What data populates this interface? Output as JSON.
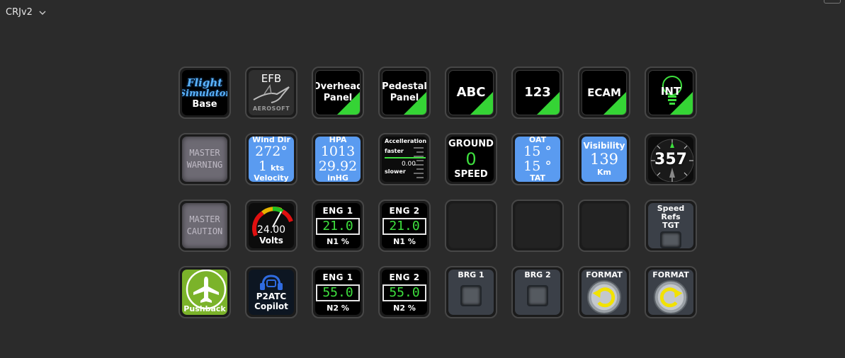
{
  "profile": {
    "name": "CRJv2"
  },
  "keys": {
    "fs_base": {
      "line1": "Flight",
      "line2": "Simulator",
      "label": "Base"
    },
    "efb": {
      "title": "EFB",
      "brand": "AEROSOFT"
    },
    "overhead": {
      "line1": "Overhead",
      "line2": "Panel"
    },
    "pedestal": {
      "line1": "Pedestal",
      "line2": "Panel"
    },
    "abc": {
      "label": "ABC"
    },
    "n123": {
      "label": "123"
    },
    "ecam": {
      "label": "ECAM"
    },
    "int": {
      "label": "INT"
    },
    "master_warning": {
      "line1": "MASTER",
      "line2": "WARNING"
    },
    "wind": {
      "title": "Wind Dir",
      "dir": "272°",
      "speed": "1",
      "unit": "kts",
      "footer": "Velocity"
    },
    "hpa": {
      "title": "HPA",
      "hpa": "1013",
      "inhg": "29.92",
      "footer": "inHG"
    },
    "accel": {
      "title": "Accelleration",
      "faster": "faster",
      "value": "0.00",
      "slower": "slower"
    },
    "ground": {
      "title": "GROUND",
      "value": "0",
      "footer": "SPEED"
    },
    "oat": {
      "title": "OAT",
      "oat": "15 °",
      "tat": "15 °",
      "footer": "TAT"
    },
    "visibility": {
      "title": "Visibility",
      "value": "139",
      "unit": "Km"
    },
    "heading": {
      "value": "357"
    },
    "master_caution": {
      "line1": "MASTER",
      "line2": "CAUTION"
    },
    "volts": {
      "value": "24.00",
      "unit": "Volts"
    },
    "eng1_n1": {
      "title": "ENG 1",
      "value": "21.0",
      "unit": "N1  %"
    },
    "eng2_n1": {
      "title": "ENG 2",
      "value": "21.0",
      "unit": "N1  %"
    },
    "speed_refs": {
      "line1": "Speed",
      "line2": "Refs",
      "line3": "TGT"
    },
    "pushback": {
      "label": "Pushback"
    },
    "p2atc": {
      "line1": "P2ATC",
      "line2": "Copilot"
    },
    "eng1_n2": {
      "title": "ENG 1",
      "value": "55.0",
      "unit": "N2  %"
    },
    "eng2_n2": {
      "title": "ENG 2",
      "value": "55.0",
      "unit": "N2  %"
    },
    "brg1": {
      "title": "BRG 1"
    },
    "brg2": {
      "title": "BRG 2"
    },
    "format_left": {
      "title": "FORMAT"
    },
    "format_right": {
      "title": "FORMAT"
    }
  },
  "colors": {
    "panel_green": "#35d435",
    "blue": "#5a9bf0",
    "digital_green": "#3ee03e",
    "pushback_green": "#7bb32a"
  }
}
